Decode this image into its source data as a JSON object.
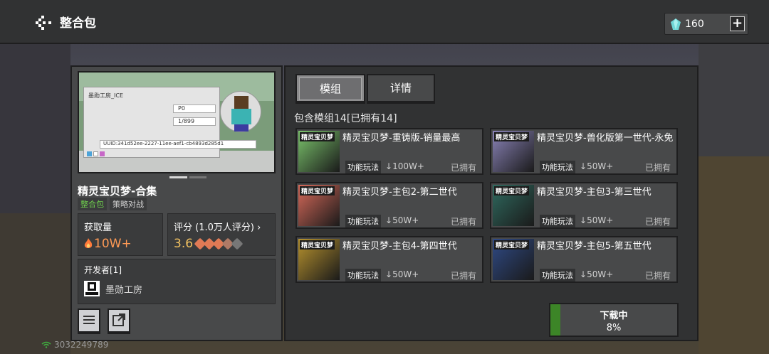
{
  "header": {
    "title": "整合包",
    "currency": "160"
  },
  "pack": {
    "title": "精灵宝贝梦-合集",
    "tags": [
      "整合包",
      "策略对战"
    ],
    "preview": {
      "player_name": "墨勋工房_ICE",
      "field_p": "P0",
      "field_count": "1/899",
      "uuid": "UUID:341d52ee-2227-11ee-aef1-cb4893d285d1"
    },
    "downloads_label": "获取量",
    "downloads_value": "10W+",
    "rating_label": "评分 (1.0万人评分)",
    "rating_value": "3.6",
    "rating_stars": 3.6,
    "developer_label": "开发者[1]",
    "developer_name": "墨勋工房"
  },
  "tabs": [
    {
      "label": "模组"
    },
    {
      "label": "详情"
    }
  ],
  "mods_heading": "包含模组14[已拥有14]",
  "mods": [
    {
      "name": "精灵宝贝梦-重铸版-销量最高",
      "category": "功能玩法",
      "downloads": "100W+",
      "status": "已拥有",
      "thumb_label": "精灵宝贝梦",
      "thumb_color": "#7bc46c"
    },
    {
      "name": "精灵宝贝梦-兽化版第一世代-永免",
      "category": "功能玩法",
      "downloads": "50W+",
      "status": "已拥有",
      "thumb_label": "精灵宝贝梦",
      "thumb_color": "#8a83b8"
    },
    {
      "name": "精灵宝贝梦-主包2-第二世代",
      "category": "功能玩法",
      "downloads": "50W+",
      "status": "已拥有",
      "thumb_label": "精灵宝贝梦",
      "thumb_color": "#d86a5a"
    },
    {
      "name": "精灵宝贝梦-主包3-第三世代",
      "category": "功能玩法",
      "downloads": "50W+",
      "status": "已拥有",
      "thumb_label": "精灵宝贝梦",
      "thumb_color": "#2f6a5f"
    },
    {
      "name": "精灵宝贝梦-主包4-第四世代",
      "category": "功能玩法",
      "downloads": "50W+",
      "status": "已拥有",
      "thumb_label": "精灵宝贝梦",
      "thumb_color": "#b8932e"
    },
    {
      "name": "精灵宝贝梦-主包5-第五世代",
      "category": "功能玩法",
      "downloads": "50W+",
      "status": "已拥有",
      "thumb_label": "精灵宝贝梦",
      "thumb_color": "#2f4a86"
    }
  ],
  "download": {
    "label": "下载中",
    "percent_text": "8%",
    "progress": 0.08
  },
  "footer": {
    "user_id": "3032249789"
  },
  "colors": {
    "accent_green": "#3c8527",
    "panel": "#48494a",
    "panel_dark": "#313233",
    "flame": "#ff7a3a"
  }
}
